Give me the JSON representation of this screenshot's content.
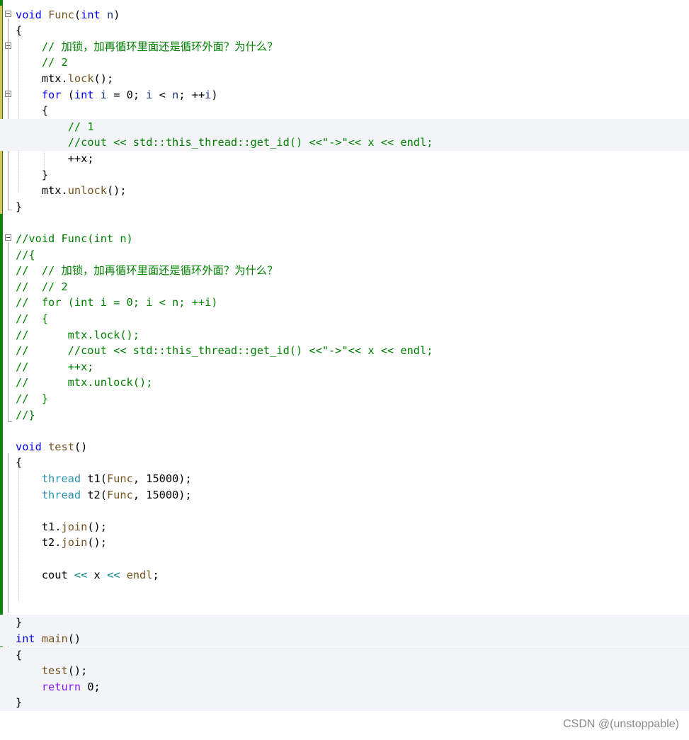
{
  "editor": {
    "lines": [
      [
        [
          "kw",
          "void"
        ],
        [
          "tx",
          " "
        ],
        [
          "fn",
          "Func"
        ],
        [
          "tx",
          "("
        ],
        [
          "kw",
          "int"
        ],
        [
          "tx",
          " "
        ],
        [
          "vr",
          "n"
        ],
        [
          "tx",
          ")"
        ]
      ],
      [
        [
          "tx",
          "{"
        ]
      ],
      [
        [
          "tx",
          "    "
        ],
        [
          "cm",
          "// 加锁，加再循环里面还是循环外面？为什么？"
        ]
      ],
      [
        [
          "tx",
          "    "
        ],
        [
          "cm",
          "// 2"
        ]
      ],
      [
        [
          "tx",
          "    "
        ],
        [
          "nm",
          "mtx"
        ],
        [
          "tx",
          "."
        ],
        [
          "fn",
          "lock"
        ],
        [
          "tx",
          "();"
        ]
      ],
      [
        [
          "tx",
          "    "
        ],
        [
          "kw",
          "for"
        ],
        [
          "tx",
          " ("
        ],
        [
          "kw",
          "int"
        ],
        [
          "tx",
          " "
        ],
        [
          "vr",
          "i"
        ],
        [
          "tx",
          " = 0; "
        ],
        [
          "vr",
          "i"
        ],
        [
          "tx",
          " < "
        ],
        [
          "vr",
          "n"
        ],
        [
          "tx",
          "; ++"
        ],
        [
          "vr",
          "i"
        ],
        [
          "tx",
          ")"
        ]
      ],
      [
        [
          "tx",
          "    {"
        ]
      ],
      [
        [
          "tx",
          "        "
        ],
        [
          "cm",
          "// 1"
        ]
      ],
      [
        [
          "tx",
          "        "
        ],
        [
          "cm",
          "//cout << std::this_thread::get_id() <<\"->\"<< x << endl;"
        ]
      ],
      [
        [
          "tx",
          "        ++"
        ],
        [
          "nm",
          "x"
        ],
        [
          "tx",
          ";"
        ]
      ],
      [
        [
          "tx",
          "    }"
        ]
      ],
      [
        [
          "tx",
          "    "
        ],
        [
          "nm",
          "mtx"
        ],
        [
          "tx",
          "."
        ],
        [
          "fn",
          "unlock"
        ],
        [
          "tx",
          "();"
        ]
      ],
      [
        [
          "tx",
          "}"
        ]
      ],
      [],
      [
        [
          "cm",
          "//void Func(int n)"
        ]
      ],
      [
        [
          "cm",
          "//{"
        ]
      ],
      [
        [
          "cm",
          "//  // 加锁，加再循环里面还是循环外面？为什么？"
        ]
      ],
      [
        [
          "cm",
          "//  // 2"
        ]
      ],
      [
        [
          "cm",
          "//  for (int i = 0; i < n; ++i)"
        ]
      ],
      [
        [
          "cm",
          "//  {"
        ]
      ],
      [
        [
          "cm",
          "//      mtx.lock();"
        ]
      ],
      [
        [
          "cm",
          "//      //cout << std::this_thread::get_id() <<\"->\"<< x << endl;"
        ]
      ],
      [
        [
          "cm",
          "//      ++x;"
        ]
      ],
      [
        [
          "cm",
          "//      mtx.unlock();"
        ]
      ],
      [
        [
          "cm",
          "//  }"
        ]
      ],
      [
        [
          "cm",
          "//}"
        ]
      ],
      [],
      [
        [
          "kw",
          "void"
        ],
        [
          "tx",
          " "
        ],
        [
          "fn",
          "test"
        ],
        [
          "tx",
          "()"
        ]
      ],
      [
        [
          "tx",
          "{"
        ]
      ],
      [
        [
          "tx",
          "    "
        ],
        [
          "ty",
          "thread"
        ],
        [
          "tx",
          " "
        ],
        [
          "nm",
          "t1"
        ],
        [
          "tx",
          "("
        ],
        [
          "fn",
          "Func"
        ],
        [
          "tx",
          ", 15000);"
        ]
      ],
      [
        [
          "tx",
          "    "
        ],
        [
          "ty",
          "thread"
        ],
        [
          "tx",
          " "
        ],
        [
          "nm",
          "t2"
        ],
        [
          "tx",
          "("
        ],
        [
          "fn",
          "Func"
        ],
        [
          "tx",
          ", 15000);"
        ]
      ],
      [],
      [
        [
          "tx",
          "    "
        ],
        [
          "nm",
          "t1"
        ],
        [
          "tx",
          "."
        ],
        [
          "fn",
          "join"
        ],
        [
          "tx",
          "();"
        ]
      ],
      [
        [
          "tx",
          "    "
        ],
        [
          "nm",
          "t2"
        ],
        [
          "tx",
          "."
        ],
        [
          "fn",
          "join"
        ],
        [
          "tx",
          "();"
        ]
      ],
      [],
      [
        [
          "tx",
          "    "
        ],
        [
          "nm",
          "cout"
        ],
        [
          "tx",
          " "
        ],
        [
          "op",
          "<<"
        ],
        [
          "tx",
          " "
        ],
        [
          "nm",
          "x"
        ],
        [
          "tx",
          " "
        ],
        [
          "op",
          "<<"
        ],
        [
          "tx",
          " "
        ],
        [
          "fn",
          "endl"
        ],
        [
          "tx",
          ";"
        ]
      ],
      [],
      [],
      [
        [
          "tx",
          "}"
        ]
      ],
      [
        [
          "kw",
          "int"
        ],
        [
          "tx",
          " "
        ],
        [
          "fn",
          "main"
        ],
        [
          "tx",
          "()"
        ]
      ],
      [
        [
          "tx",
          "{"
        ]
      ],
      [
        [
          "tx",
          "    "
        ],
        [
          "fn",
          "test"
        ],
        [
          "tx",
          "();"
        ]
      ],
      [
        [
          "tx",
          "    "
        ],
        [
          "mb",
          "return"
        ],
        [
          "tx",
          " 0;"
        ]
      ],
      [
        [
          "tx",
          "}"
        ]
      ]
    ],
    "highlighted_lines": [
      7,
      8,
      38,
      39,
      40,
      41,
      42,
      43
    ],
    "colors": {
      "keyword": "#0000ff",
      "type": "#2b91af",
      "comment": "#008000",
      "function": "#74531f",
      "change_saved": "#108010",
      "change_unsaved": "#e2c05a"
    }
  },
  "watermark": "CSDN @(unstoppable)"
}
